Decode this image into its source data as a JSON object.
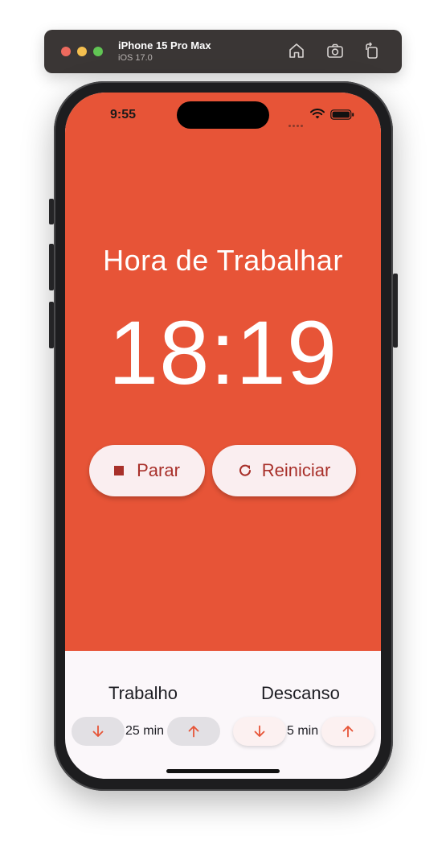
{
  "simulator": {
    "device_name": "iPhone 15 Pro Max",
    "os_version": "iOS 17.0",
    "icons": [
      "home-icon",
      "screenshot-icon",
      "rotate-icon"
    ]
  },
  "status_bar": {
    "time": "9:55",
    "icons": [
      "wifi-icon",
      "battery-icon"
    ]
  },
  "timer_screen": {
    "phase_title": "Hora de Trabalhar",
    "time_remaining": "18:19",
    "background_color": "#e75437",
    "stop_button": {
      "label": "Parar",
      "icon": "stop-icon"
    },
    "reset_button": {
      "label": "Reiniciar",
      "icon": "refresh-icon"
    }
  },
  "settings": {
    "work": {
      "label": "Trabalho",
      "value": "25 min",
      "decrease_icon": "arrow-down-icon",
      "increase_icon": "arrow-up-icon"
    },
    "rest": {
      "label": "Descanso",
      "value": "5 min",
      "decrease_icon": "arrow-down-icon",
      "increase_icon": "arrow-up-icon"
    }
  },
  "colors": {
    "accent": "#e75437",
    "button_text": "#a8302a",
    "button_background": "#faeef0"
  }
}
